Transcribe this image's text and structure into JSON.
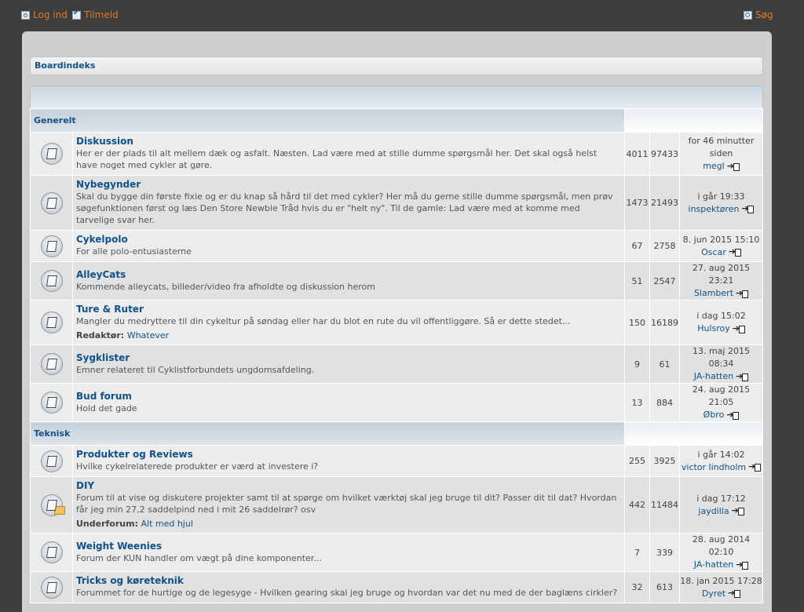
{
  "topbar": {
    "login": "Log ind",
    "register": "Tilmeld",
    "search": "Søg"
  },
  "breadcrumb": "Boardindeks",
  "categories": [
    {
      "name": "Generelt",
      "forums": [
        {
          "title": "Diskussion",
          "desc": "Her er der plads til alt mellem dæk og asfalt. Næsten. Lad være med at stille dumme spørgsmål her. Det skal også helst have noget med cykler at gøre.",
          "topics": "4011",
          "posts": "97433",
          "last_time": "for 46 minutter siden",
          "last_user": "megl"
        },
        {
          "title": "Nybegynder",
          "desc": "Skal du bygge din første fixie og er du knap så hård til det med cykler? Her må du gerne stille dumme spørgsmål, men prøv søgefunktionen først og læs Den Store Newbie Tråd hvis du er \"helt ny\". Til de gamle: Lad være med at komme med tarvelige svar her.",
          "topics": "1473",
          "posts": "21493",
          "last_time": "i går 19:33",
          "last_user": "inspektøren"
        },
        {
          "title": "Cykelpolo",
          "desc": "For alle polo-entusiasterne",
          "topics": "67",
          "posts": "2758",
          "last_time": "8. jun 2015 15:10",
          "last_user": "Oscar"
        },
        {
          "title": "AlleyCats",
          "desc": "Kommende alleycats, billeder/video fra afholdte og diskussion herom",
          "topics": "51",
          "posts": "2547",
          "last_time": "27. aug 2015 23:21",
          "last_user": "Slambert"
        },
        {
          "title": "Ture & Ruter",
          "desc": "Mangler du medryttere til din cykeltur på søndag eller har du blot en rute du vil offentliggøre. Så er dette stedet...",
          "mods_label": "Redaktør:",
          "mods_value": "Whatever",
          "topics": "150",
          "posts": "16189",
          "last_time": "i dag 15:02",
          "last_user": "Hulsroy"
        },
        {
          "title": "Sygklister",
          "desc": "Emner relateret til Cyklistforbundets ungdomsafdeling.",
          "topics": "9",
          "posts": "61",
          "last_time": "13. maj 2015 08:34",
          "last_user": "JA-hatten"
        },
        {
          "title": "Bud forum",
          "desc": "Hold det gade",
          "topics": "13",
          "posts": "884",
          "last_time": "24. aug 2015 21:05",
          "last_user": "Øbro"
        }
      ]
    },
    {
      "name": "Teknisk",
      "forums": [
        {
          "title": "Produkter og Reviews",
          "desc": "Hvilke cykelrelaterede produkter er værd at investere i?",
          "topics": "255",
          "posts": "3925",
          "last_time": "i går 14:02",
          "last_user": "victor lindholm"
        },
        {
          "title": "DIY",
          "desc": "Forum til at vise og diskutere projekter samt til at spørge om hvilket værktøj skal jeg bruge til dit? Passer dit til dat? Hvordan får jeg min 27,2 saddelpind ned i mit 26 saddelrør? osv",
          "mods_label": "Underforum:",
          "mods_value": "Alt med hjul",
          "subforum": true,
          "topics": "442",
          "posts": "11484",
          "last_time": "i dag 17:12",
          "last_user": "jaydilla"
        },
        {
          "title": "Weight Weenies",
          "desc": "Forum der KUN handler om vægt på dine komponenter...",
          "topics": "7",
          "posts": "339",
          "last_time": "28. aug 2014 02:10",
          "last_user": "JA-hatten"
        },
        {
          "title": "Tricks og køreteknik",
          "desc": "Forummet for de hurtige og de legesyge - Hvilken gearing skal jeg bruge og hvordan var det nu med de der baglæns cirkler?",
          "topics": "32",
          "posts": "613",
          "last_time": "18. jan 2015 17:28",
          "last_user": "Dyret"
        }
      ]
    }
  ]
}
